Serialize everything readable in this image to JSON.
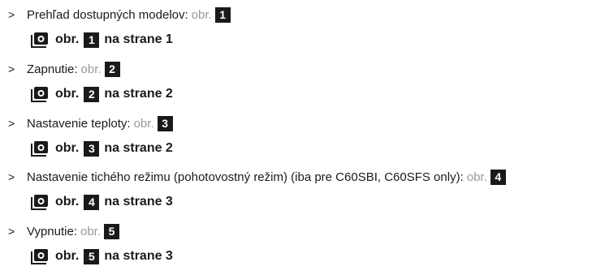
{
  "items": [
    {
      "text": "Prehľad dostupných modelov:",
      "obr": "obr.",
      "num": "1",
      "ref": {
        "obr": "obr.",
        "num": "1",
        "page_text": "na strane 1"
      }
    },
    {
      "text": "Zapnutie:",
      "obr": "obr.",
      "num": "2",
      "ref": {
        "obr": "obr.",
        "num": "2",
        "page_text": "na strane 2"
      }
    },
    {
      "text": "Nastavenie teploty:",
      "obr": "obr.",
      "num": "3",
      "ref": {
        "obr": "obr.",
        "num": "3",
        "page_text": "na strane 2"
      }
    },
    {
      "text": "Nastavenie tichého režimu (pohotovostný režim) (iba pre C60SBI, C60SFS only):",
      "obr": "obr.",
      "num": "4",
      "ref": {
        "obr": "obr.",
        "num": "4",
        "page_text": "na strane 3"
      }
    },
    {
      "text": "Vypnutie:",
      "obr": "obr.",
      "num": "5",
      "ref": {
        "obr": "obr.",
        "num": "5",
        "page_text": "na strane 3"
      }
    }
  ],
  "bullet_glyph": ">",
  "icons": {
    "reference": "camera-icon"
  },
  "colors": {
    "text": "#1a1a1a",
    "muted": "#9a9a9a",
    "badge_bg": "#1a1a1a",
    "badge_fg": "#ffffff"
  }
}
